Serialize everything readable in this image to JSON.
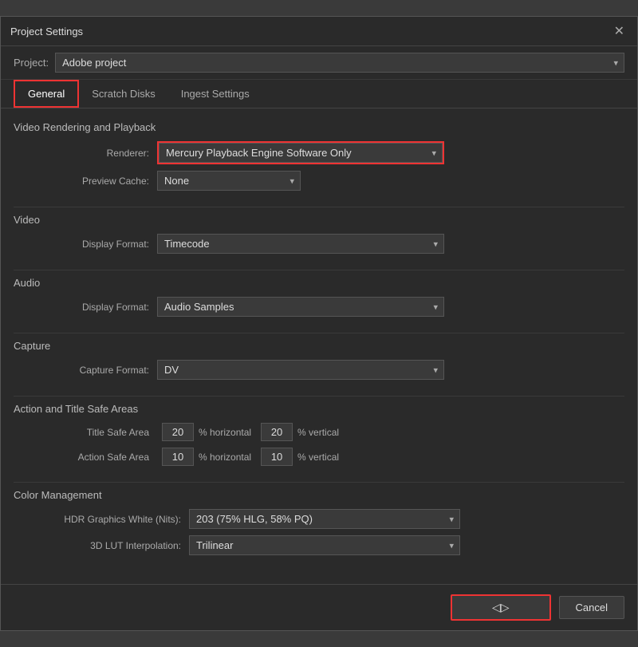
{
  "title": "Project Settings",
  "close_icon": "✕",
  "project": {
    "label": "Project:",
    "value": "Adobe project"
  },
  "tabs": [
    {
      "label": "General",
      "active": true
    },
    {
      "label": "Scratch Disks",
      "active": false
    },
    {
      "label": "Ingest Settings",
      "active": false
    }
  ],
  "sections": {
    "video_rendering": {
      "title": "Video Rendering and Playback",
      "renderer_label": "Renderer:",
      "renderer_value": "Mercury Playback Engine Software Only",
      "preview_cache_label": "Preview Cache:",
      "preview_cache_value": "None"
    },
    "video": {
      "title": "Video",
      "display_format_label": "Display Format:",
      "display_format_value": "Timecode"
    },
    "audio": {
      "title": "Audio",
      "display_format_label": "Display Format:",
      "display_format_value": "Audio Samples"
    },
    "capture": {
      "title": "Capture",
      "capture_format_label": "Capture Format:",
      "capture_format_value": "DV"
    },
    "safe_areas": {
      "title": "Action and Title Safe Areas",
      "title_safe_label": "Title Safe Area",
      "title_safe_h": "20",
      "title_safe_v": "20",
      "action_safe_label": "Action Safe Area",
      "action_safe_h": "10",
      "action_safe_v": "10",
      "percent_horizontal": "% horizontal",
      "percent_vertical": "% vertical"
    },
    "color_management": {
      "title": "Color Management",
      "hdr_label": "HDR Graphics White (Nits):",
      "hdr_value": "203 (75% HLG, 58% PQ)",
      "lut_label": "3D LUT Interpolation:",
      "lut_value": "Trilinear"
    }
  },
  "footer": {
    "ok_icon": "◁▷",
    "cancel_label": "Cancel"
  }
}
